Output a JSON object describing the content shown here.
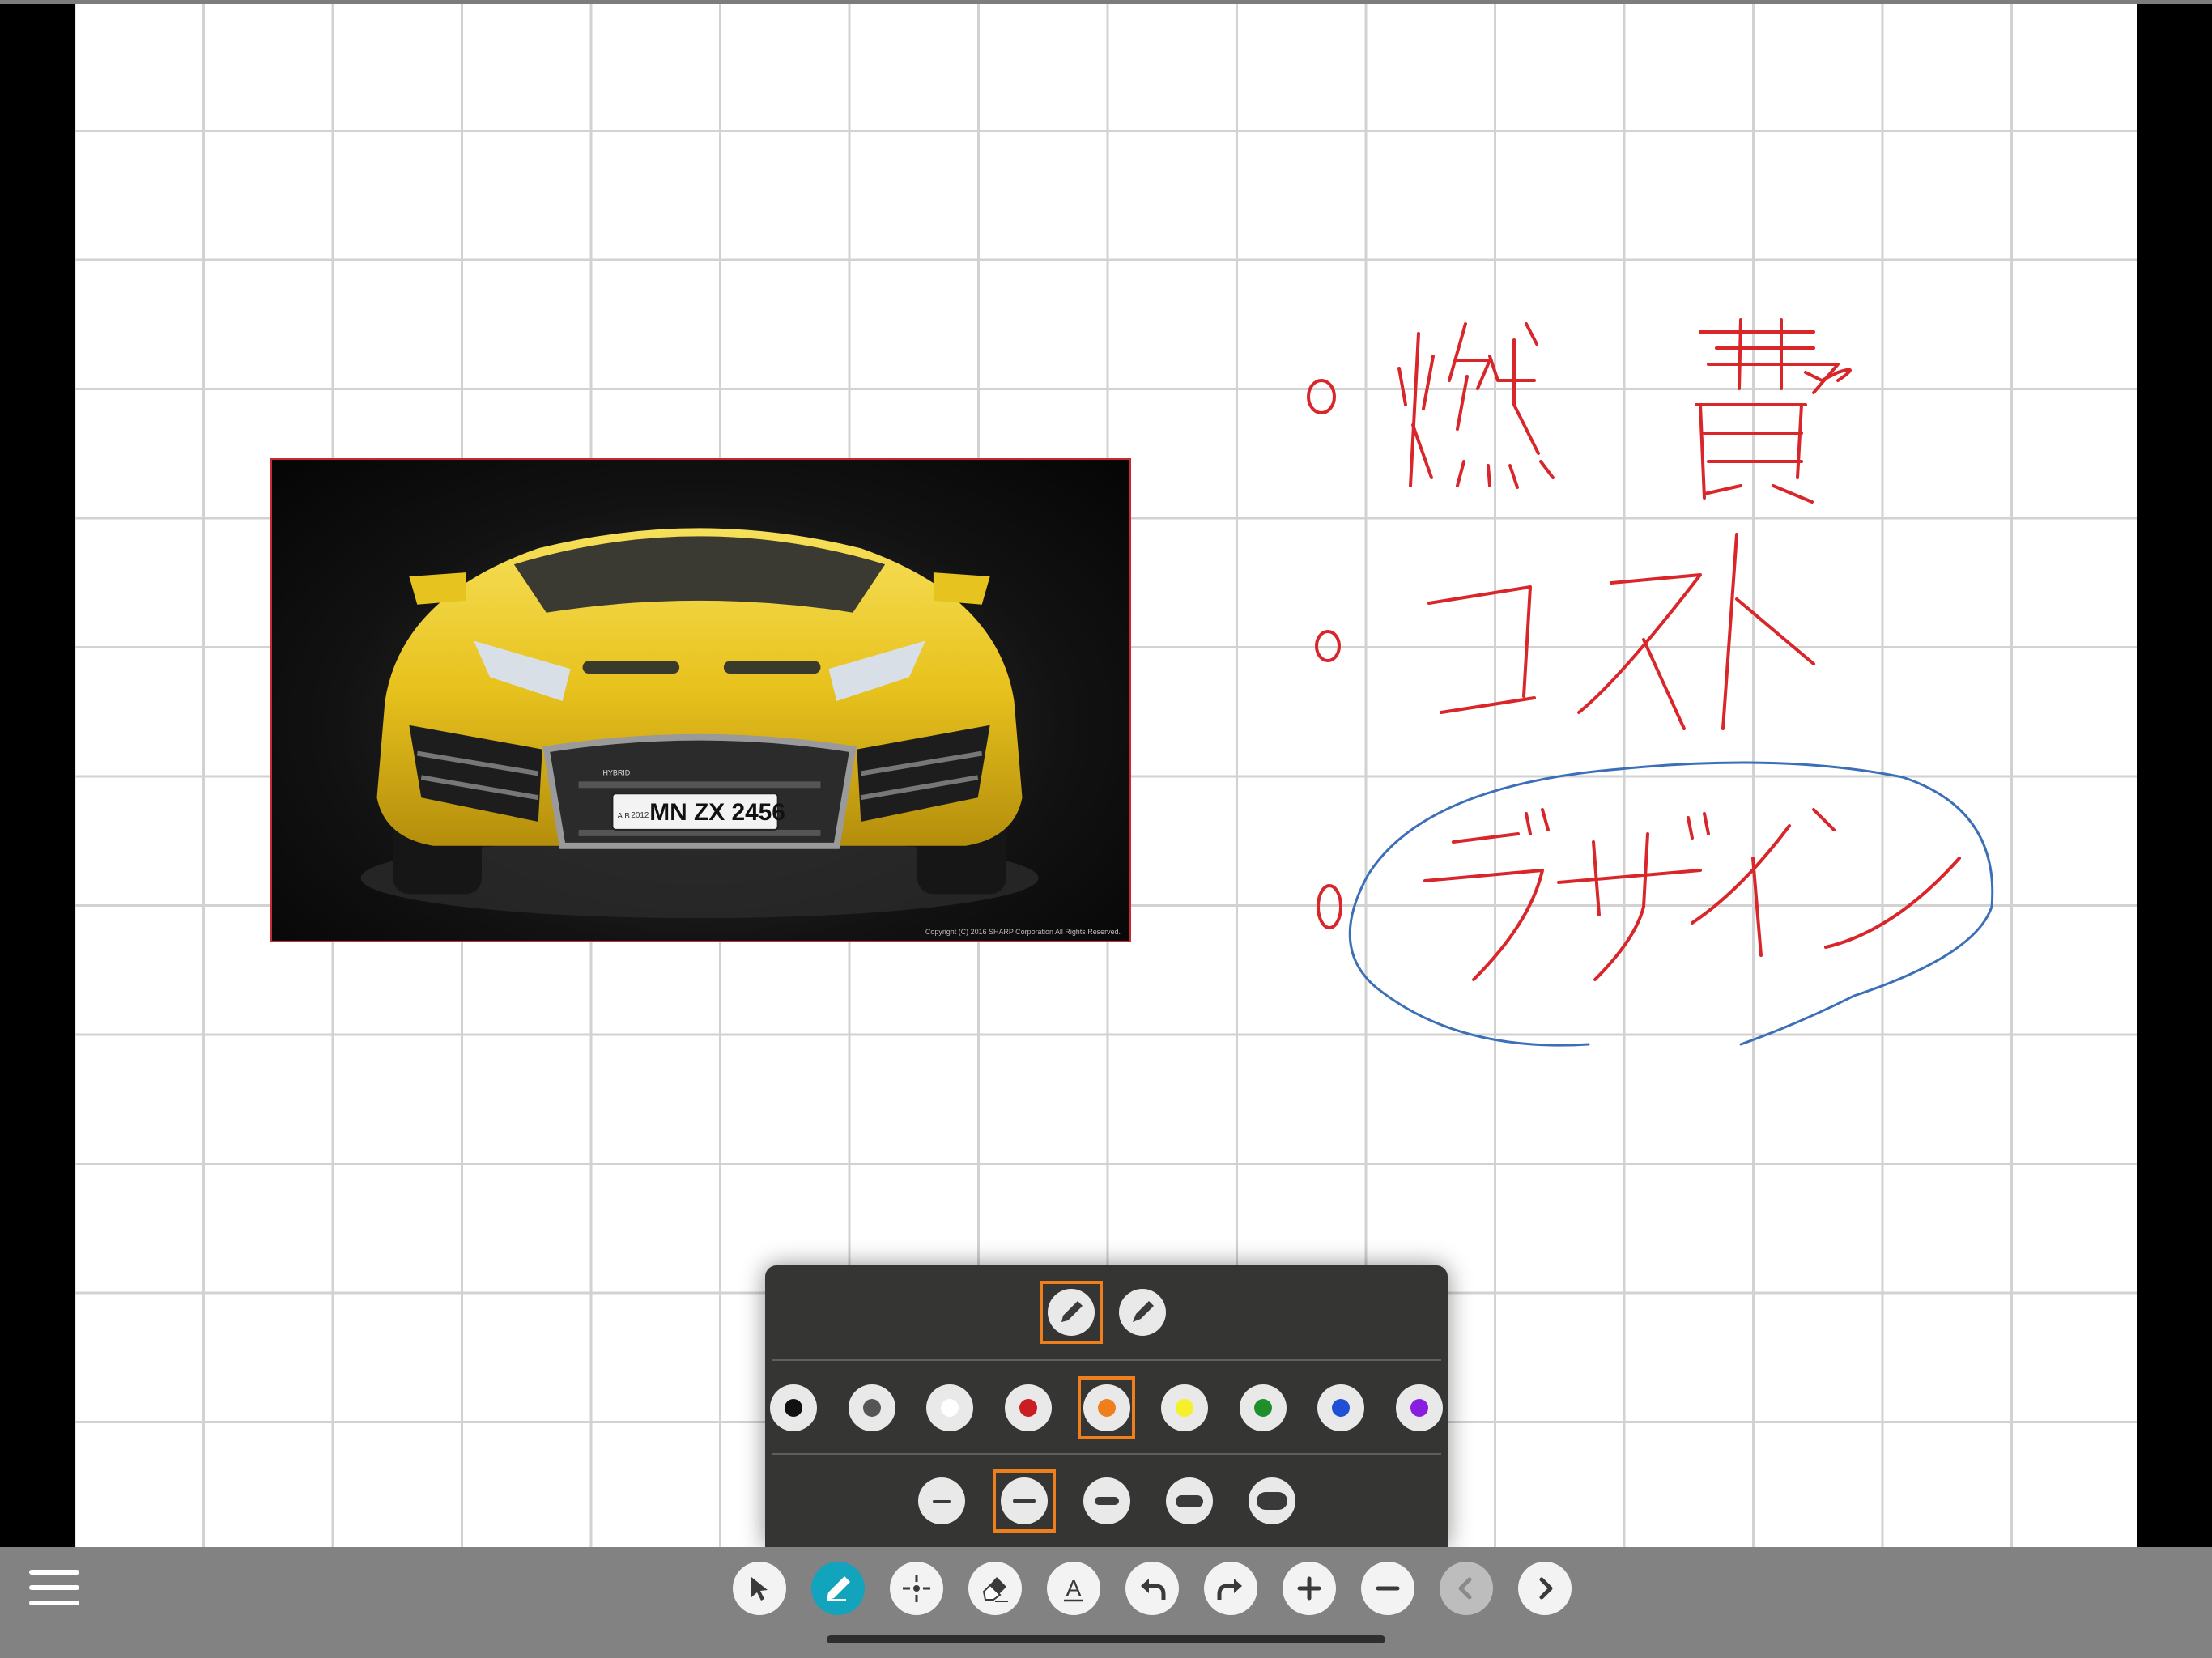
{
  "app": {
    "canvas": {
      "background": "#ffffff",
      "grid_color": "#d2d2d2",
      "letterbox_color": "#000000"
    }
  },
  "photo": {
    "subject": "yellow sports car",
    "badge_text": "HYBRID",
    "plate_side": "A B",
    "plate_year": "2012",
    "plate_text": "MN ZX 2456",
    "copyright": "Copyright (C) 2016 SHARP Corporation All Rights Reserved."
  },
  "handwriting": {
    "items": [
      "燃費",
      "コスト",
      "デザイン"
    ],
    "ink_color": "#d8262a",
    "circle_color": "#3b6fb8",
    "circled_item": "デザイン"
  },
  "pen_panel": {
    "pen_types": [
      {
        "name": "pen-type-1",
        "selected": true
      },
      {
        "name": "pen-type-2",
        "selected": false
      }
    ],
    "colors": [
      {
        "name": "black",
        "hex": "#111111",
        "selected": false
      },
      {
        "name": "gray",
        "hex": "#555555",
        "selected": false
      },
      {
        "name": "white",
        "hex": "#ffffff",
        "selected": false
      },
      {
        "name": "red",
        "hex": "#c81e24",
        "selected": false
      },
      {
        "name": "orange",
        "hex": "#ef7e1c",
        "selected": true
      },
      {
        "name": "yellow",
        "hex": "#f4f02a",
        "selected": false
      },
      {
        "name": "green",
        "hex": "#1f8f2c",
        "selected": false
      },
      {
        "name": "blue",
        "hex": "#1e4fd4",
        "selected": false
      },
      {
        "name": "purple",
        "hex": "#8a1ee0",
        "selected": false
      }
    ],
    "widths": [
      {
        "name": "width-1",
        "selected": false
      },
      {
        "name": "width-2",
        "selected": true
      },
      {
        "name": "width-3",
        "selected": false
      },
      {
        "name": "width-4",
        "selected": false
      },
      {
        "name": "width-5",
        "selected": false
      }
    ],
    "selection_color": "#ef7e1c"
  },
  "toolbar": {
    "background": "#828282",
    "active_color": "#12a3bd",
    "tools": [
      {
        "icon": "select-arrow-icon",
        "active": false
      },
      {
        "icon": "pen-icon",
        "active": true
      },
      {
        "icon": "pointer-crosshair-icon",
        "active": false
      },
      {
        "icon": "eraser-icon",
        "active": false
      },
      {
        "icon": "text-icon",
        "label": "A",
        "active": false
      },
      {
        "icon": "undo-icon",
        "active": false
      },
      {
        "icon": "redo-icon",
        "active": false
      },
      {
        "icon": "zoom-in-icon",
        "active": false
      },
      {
        "icon": "zoom-out-icon",
        "active": false
      },
      {
        "icon": "previous-page-icon",
        "active": false,
        "disabled": true
      },
      {
        "icon": "next-page-icon",
        "active": false
      }
    ]
  }
}
